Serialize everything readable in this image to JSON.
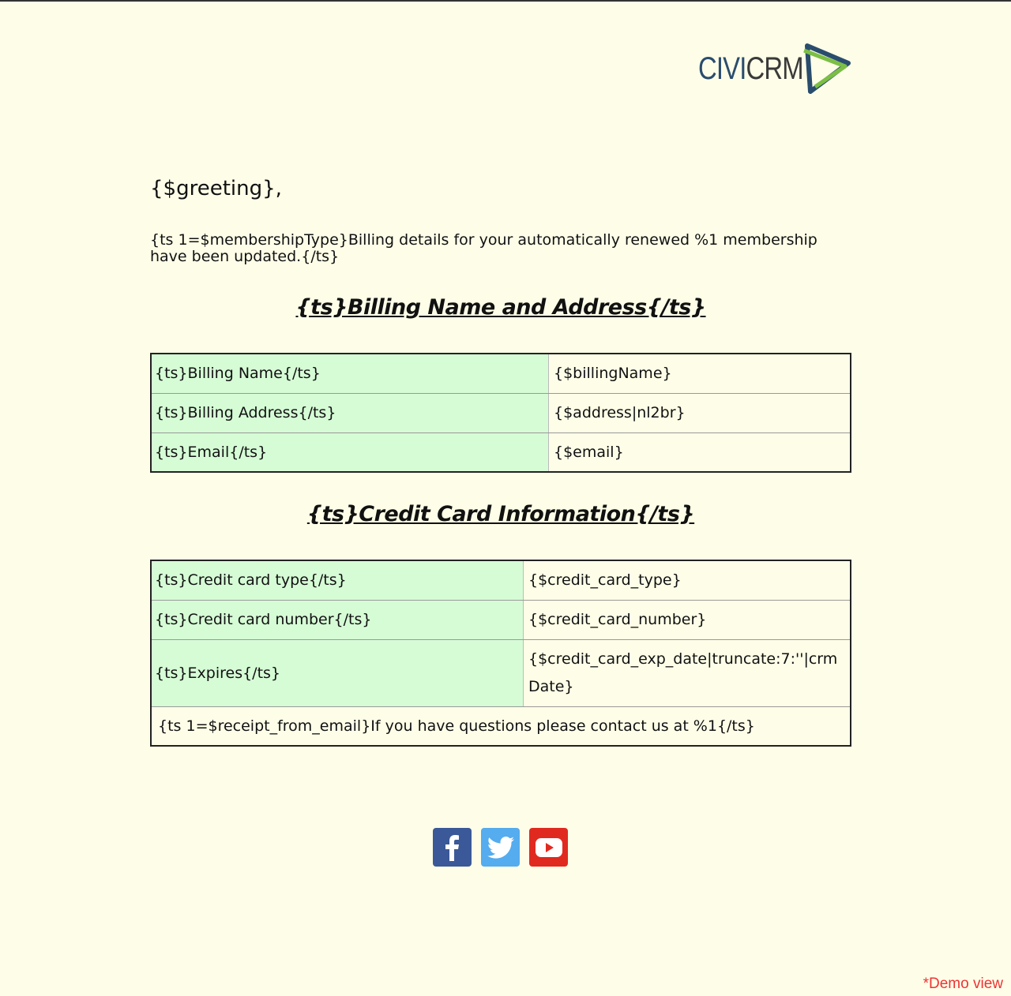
{
  "header": {
    "logo_text_civi": "CIVI",
    "logo_text_crm": "CRM",
    "brand_colors": {
      "blue": "#2a4d6e",
      "green": "#7bbf44"
    }
  },
  "greeting": "{$greeting},",
  "intro": "{ts 1=$membershipType}Billing details for your automatically renewed %1 membership have been updated.{/ts}",
  "billing": {
    "title": "{ts}Billing Name and Address{/ts}",
    "rows": [
      {
        "label": "{ts}Billing Name{/ts}",
        "value": "{$billingName}"
      },
      {
        "label": "{ts}Billing Address{/ts}",
        "value": "{$address|nl2br}"
      },
      {
        "label": "{ts}Email{/ts}",
        "value": "{$email}"
      }
    ]
  },
  "credit_card": {
    "title": "{ts}Credit Card Information{/ts}",
    "rows": [
      {
        "label": "{ts}Credit card type{/ts}",
        "value": "{$credit_card_type}"
      },
      {
        "label": "{ts}Credit card number{/ts}",
        "value": "{$credit_card_number}"
      },
      {
        "label": "{ts}Expires{/ts}",
        "value": "{$credit_card_exp_date|truncate:7:''|crmDate}"
      }
    ],
    "footer": "{ts 1=$receipt_from_email}If you have questions please contact us at %1{/ts}"
  },
  "social": [
    {
      "icon": "facebook-icon",
      "color": "#3b5998"
    },
    {
      "icon": "twitter-icon",
      "color": "#55acee"
    },
    {
      "icon": "youtube-icon",
      "color": "#e02a20"
    }
  ],
  "demo_label": "*Demo view"
}
